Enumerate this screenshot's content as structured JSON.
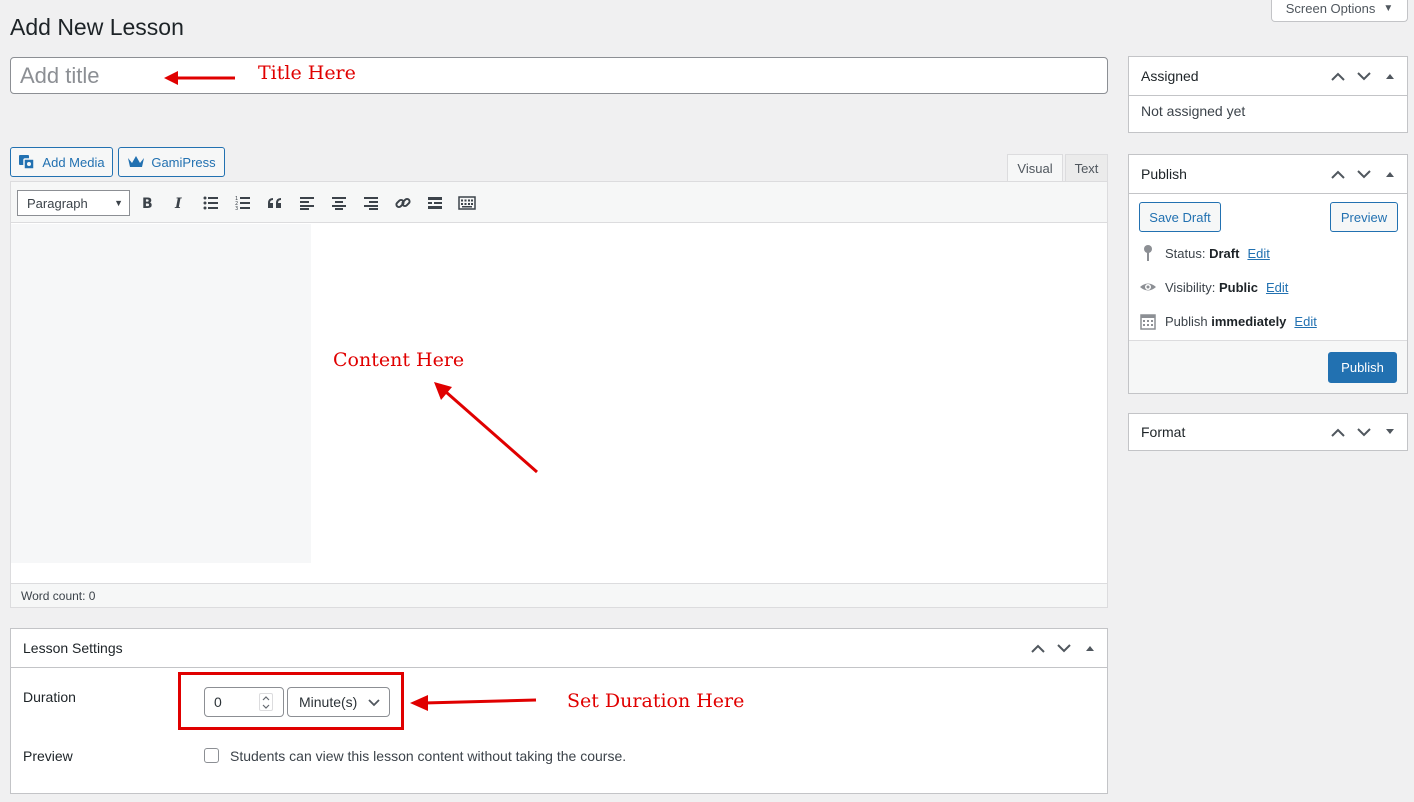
{
  "page": {
    "title": "Add New Lesson"
  },
  "screen_options": {
    "label": "Screen Options"
  },
  "title_field": {
    "placeholder": "Add title"
  },
  "annotations": {
    "title": "Title Here",
    "content": "Content Here",
    "duration": "Set Duration Here",
    "color": "#e00000"
  },
  "media_buttons": {
    "add_media": "Add Media",
    "gamipress": "GamiPress"
  },
  "editor_tabs": {
    "visual": "Visual",
    "text": "Text"
  },
  "toolbar": {
    "format": "Paragraph",
    "icons": [
      "bold-icon",
      "italic-icon",
      "bullet-list-icon",
      "numbered-list-icon",
      "blockquote-icon",
      "align-left-icon",
      "align-center-icon",
      "align-right-icon",
      "link-icon",
      "read-more-icon",
      "toolbar-toggle-icon"
    ]
  },
  "status_bar": {
    "word_count": "Word count: 0"
  },
  "lesson_settings": {
    "title": "Lesson Settings",
    "duration_label": "Duration",
    "duration_value": "0",
    "duration_unit": "Minute(s)",
    "preview_label": "Preview",
    "preview_text": "Students can view this lesson content without taking the course."
  },
  "assigned": {
    "title": "Assigned",
    "text": "Not assigned yet"
  },
  "publish": {
    "title": "Publish",
    "save_draft": "Save Draft",
    "preview": "Preview",
    "status_label": "Status:",
    "status_value": "Draft",
    "visibility_label": "Visibility:",
    "visibility_value": "Public",
    "schedule_label": "Publish",
    "schedule_value": "immediately",
    "edit": "Edit",
    "publish_button": "Publish"
  },
  "format_box": {
    "title": "Format"
  },
  "colors": {
    "primary": "#2271b1",
    "background": "#f0f0f1",
    "annotation": "#e00000"
  }
}
